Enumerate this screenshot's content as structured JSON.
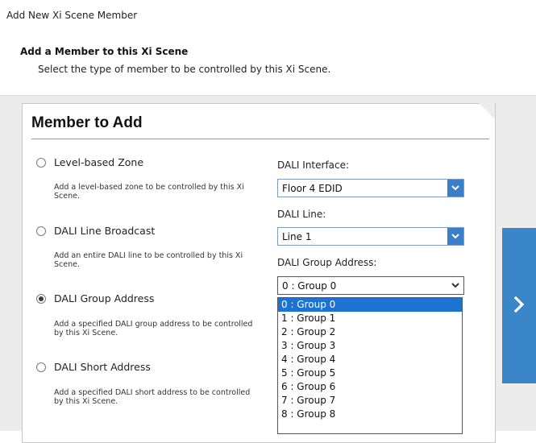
{
  "dialog": {
    "title": "Add New Xi Scene Member",
    "heading": "Add a Member to this Xi Scene",
    "subheading": "Select the type of member to be controlled by this Xi Scene."
  },
  "panel": {
    "title": "Member to Add",
    "options": [
      {
        "label": "Level-based Zone",
        "description": "Add a level-based zone to be controlled by this Xi Scene.",
        "checked": false
      },
      {
        "label": "DALI Line Broadcast",
        "description": "Add an entire DALI line to be controlled by this Xi Scene.",
        "checked": false
      },
      {
        "label": "DALI Group Address",
        "description": "Add a specified DALI group address to be controlled by this Xi Scene.",
        "checked": true
      },
      {
        "label": "DALI Short Address",
        "description": "Add a specified DALI short address to be controlled by this Xi Scene.",
        "checked": false
      }
    ],
    "dali_interface": {
      "label": "DALI Interface:",
      "value": "Floor 4 EDID"
    },
    "dali_line": {
      "label": "DALI Line:",
      "value": "Line 1"
    },
    "dali_group": {
      "label": "DALI Group Address:",
      "value": "0 : Group 0",
      "options": [
        "0 : Group 0",
        "1 : Group 1",
        "2 : Group 2",
        "3 : Group 3",
        "4 : Group 4",
        "5 : Group 5",
        "6 : Group 6",
        "7 : Group 7",
        "8 : Group 8"
      ],
      "highlighted_index": 0
    }
  },
  "icons": {
    "next": "chevron-right-icon",
    "dropdown": "chevron-down-icon"
  },
  "colors": {
    "accent": "#3b85c9",
    "selection": "#1e72d2"
  }
}
